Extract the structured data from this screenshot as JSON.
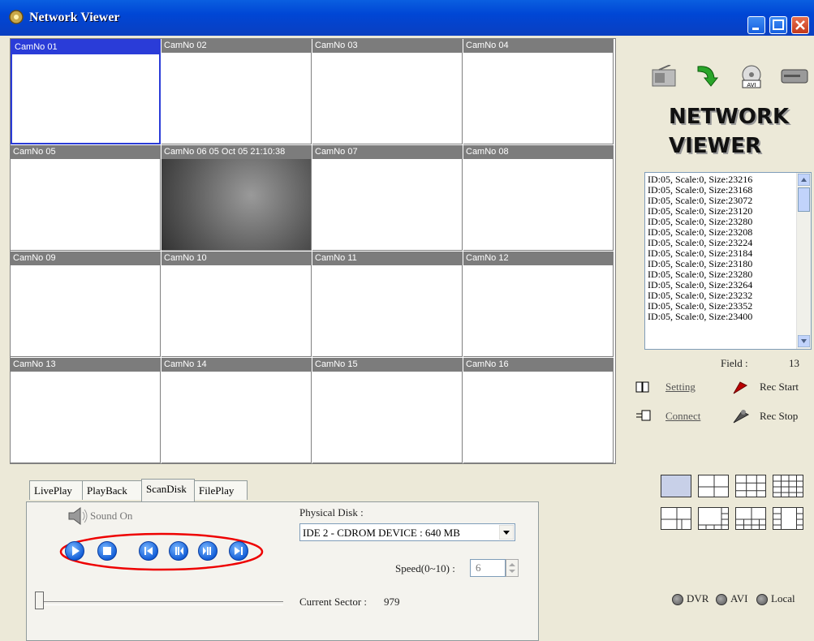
{
  "window": {
    "title": "Network Viewer"
  },
  "cameras": [
    {
      "label": "CamNo 01"
    },
    {
      "label": "CamNo 02"
    },
    {
      "label": "CamNo 03"
    },
    {
      "label": "CamNo 04"
    },
    {
      "label": "CamNo 05"
    },
    {
      "label": "CamNo 06 05 Oct 05 21:10:38"
    },
    {
      "label": "CamNo 07"
    },
    {
      "label": "CamNo 08"
    },
    {
      "label": "CamNo 09"
    },
    {
      "label": "CamNo 10"
    },
    {
      "label": "CamNo 11"
    },
    {
      "label": "CamNo 12"
    },
    {
      "label": "CamNo 13"
    },
    {
      "label": "CamNo 14"
    },
    {
      "label": "CamNo 15"
    },
    {
      "label": "CamNo 16"
    }
  ],
  "brand": {
    "line1": "NETWORK",
    "line2": "VIEWER"
  },
  "log": [
    "ID:05, Scale:0, Size:23216",
    "ID:05, Scale:0, Size:23168",
    "ID:05, Scale:0, Size:23072",
    "ID:05, Scale:0, Size:23120",
    "ID:05, Scale:0, Size:23280",
    "ID:05, Scale:0, Size:23208",
    "ID:05, Scale:0, Size:23224",
    "ID:05, Scale:0, Size:23184",
    "ID:05, Scale:0, Size:23180",
    "ID:05, Scale:0, Size:23280",
    "ID:05, Scale:0, Size:23264",
    "ID:05, Scale:0, Size:23232",
    "ID:05, Scale:0, Size:23352",
    "ID:05, Scale:0, Size:23400"
  ],
  "field": {
    "label": "Field :",
    "value": "13"
  },
  "actions": {
    "setting": "Setting",
    "rec_start": "Rec Start",
    "connect": "Connect",
    "rec_stop": "Rec Stop"
  },
  "tabs": [
    "LivePlay",
    "PlayBack",
    "ScanDisk",
    "FilePlay"
  ],
  "scan": {
    "sound": "Sound On",
    "disk_label": "Physical Disk :",
    "disk_value": "IDE 2 - CDROM DEVICE : 640 MB",
    "speed_label": "Speed(0~10) :",
    "speed_value": "6",
    "sector_label": "Current Sector :",
    "sector_value": "979"
  },
  "modes": {
    "dvr": "DVR",
    "avi": "AVI",
    "local": "Local"
  }
}
